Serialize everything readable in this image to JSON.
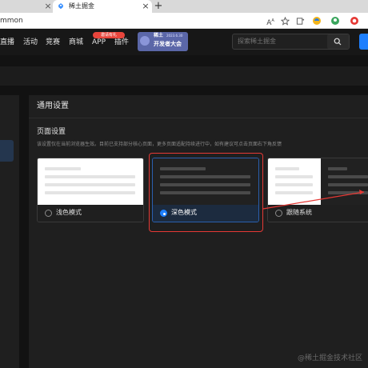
{
  "browser": {
    "tab_title": "稀土掘金",
    "url_fragment": "mmon"
  },
  "header": {
    "nav": [
      "直播",
      "活动",
      "竞赛",
      "商城",
      "APP",
      "插件"
    ],
    "app_badge": "邀请有礼",
    "banner": {
      "title": "稀土",
      "date": "2023.6.30",
      "subtitle": "开发者大会"
    },
    "search_placeholder": "探索稀土掘金"
  },
  "settings": {
    "panel_title": "通用设置",
    "section_title": "页面设置",
    "description": "该设置仅在当前浏览器生效。目前已支持部分核心页面，更多页面适配持续进行中，如有建议可点击页面右下角反馈",
    "themes": [
      {
        "label": "浅色模式",
        "selected": false
      },
      {
        "label": "深色模式",
        "selected": true
      },
      {
        "label": "跟随系统",
        "selected": false
      }
    ]
  },
  "colors": {
    "accent": "#1e80ff",
    "highlight": "#e53935",
    "background": "#121212",
    "panel": "#1f1f1f"
  },
  "watermark": "@稀土掘金技术社区"
}
